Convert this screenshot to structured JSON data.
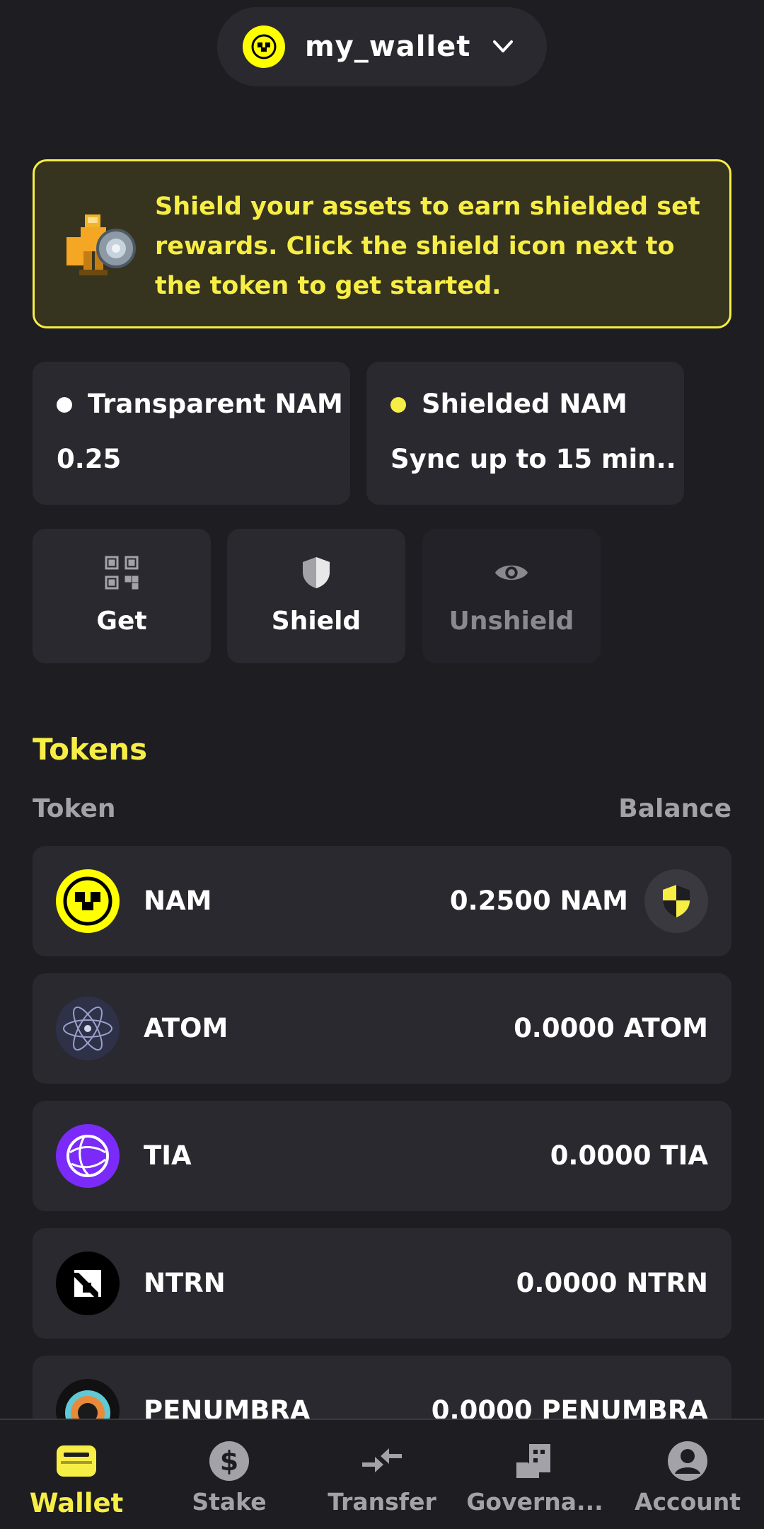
{
  "header": {
    "wallet_name": "my_wallet",
    "logo_icon": "namada-logo-icon",
    "chevron_icon": "chevron-down-icon"
  },
  "banner": {
    "text": "Shield your assets to earn shielded set rewards. Click the shield icon next to the token to get started.",
    "icon": "shield-knight-icon"
  },
  "balances": {
    "transparent": {
      "label": "Transparent NAM",
      "value": "0.25",
      "dot_color": "#ffffff"
    },
    "shielded": {
      "label": "Shielded NAM",
      "value": "Sync up to 15 min..",
      "dot_color": "#f7ee45"
    }
  },
  "actions": {
    "get": {
      "label": "Get",
      "icon": "qr-code-icon"
    },
    "shield": {
      "label": "Shield",
      "icon": "shield-icon"
    },
    "unshield": {
      "label": "Unshield",
      "icon": "eye-icon"
    }
  },
  "tokens": {
    "title": "Tokens",
    "col_token": "Token",
    "col_balance": "Balance",
    "rows": [
      {
        "symbol": "NAM",
        "balance": "0.2500 NAM",
        "icon": "nam-logo",
        "shieldable": true
      },
      {
        "symbol": "ATOM",
        "balance": "0.0000 ATOM",
        "icon": "atom-logo",
        "shieldable": false
      },
      {
        "symbol": "TIA",
        "balance": "0.0000 TIA",
        "icon": "tia-logo",
        "shieldable": false
      },
      {
        "symbol": "NTRN",
        "balance": "0.0000 NTRN",
        "icon": "ntrn-logo",
        "shieldable": false
      },
      {
        "symbol": "PENUMBRA",
        "balance": "0.0000 PENUMBRA",
        "icon": "penumbra-logo",
        "shieldable": false
      }
    ]
  },
  "nav": {
    "items": [
      {
        "label": "Wallet",
        "icon": "wallet-icon",
        "active": true
      },
      {
        "label": "Stake",
        "icon": "dollar-icon",
        "active": false
      },
      {
        "label": "Transfer",
        "icon": "transfer-icon",
        "active": false
      },
      {
        "label": "Governa...",
        "icon": "governance-icon",
        "active": false
      },
      {
        "label": "Account",
        "icon": "account-icon",
        "active": false
      }
    ]
  },
  "colors": {
    "accent": "#f7ee45",
    "background": "#1e1d22",
    "card": "#2a292f"
  }
}
